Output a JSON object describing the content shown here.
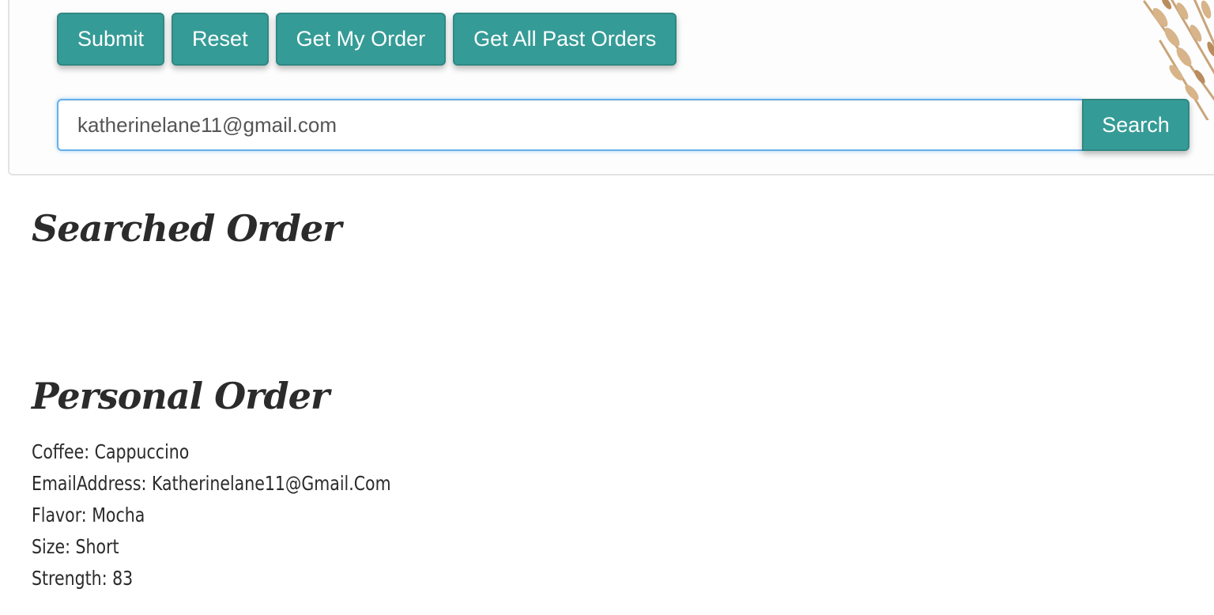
{
  "buttons": {
    "submit": "Submit",
    "reset": "Reset",
    "get_my_order": "Get My Order",
    "get_all_past_orders": "Get All Past Orders"
  },
  "search": {
    "value": "katherinelane11@gmail.com",
    "button_label": "Search"
  },
  "searched_order": {
    "title": "Searched Order"
  },
  "personal_order": {
    "title": "Personal Order",
    "fields": [
      {
        "label": "Coffee",
        "value": "Cappuccino"
      },
      {
        "label": "EmailAddress",
        "value": "Katherinelane11@Gmail.Com"
      },
      {
        "label": "Flavor",
        "value": "Mocha"
      },
      {
        "label": "Size",
        "value": "Short"
      },
      {
        "label": "Strength",
        "value": "83"
      }
    ]
  },
  "colors": {
    "button_teal": "#359b96",
    "input_focus_border": "#66afe9",
    "heading_text": "#2b2b2b"
  },
  "icons": {
    "decor": "dried-flowers-decoration-icon"
  }
}
